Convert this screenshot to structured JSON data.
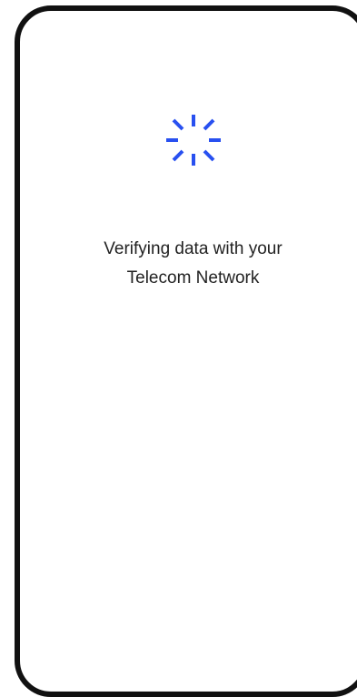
{
  "screen": {
    "loader_icon": "spinner-icon",
    "accent_color": "#2850F0",
    "message": {
      "line1": "Verifying data with your",
      "line2": "Telecom Network"
    }
  }
}
